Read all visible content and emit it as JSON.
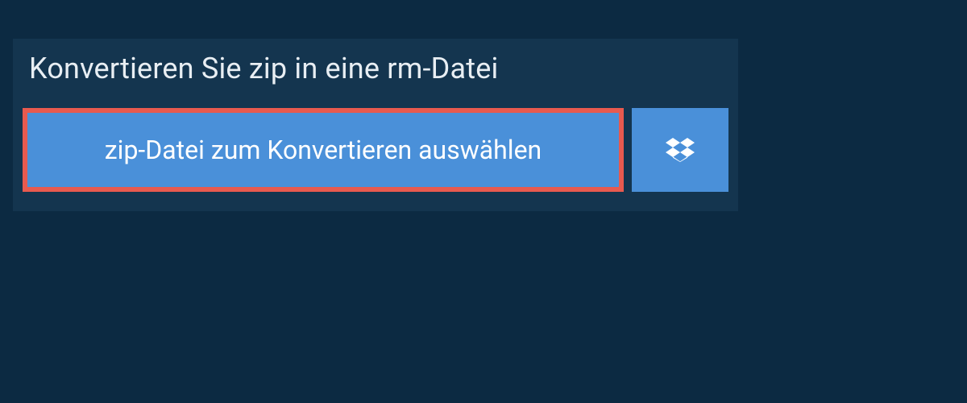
{
  "heading": "Konvertieren Sie zip in eine rm-Datei",
  "buttons": {
    "select_file_label": "zip-Datei zum Konvertieren auswählen"
  }
}
